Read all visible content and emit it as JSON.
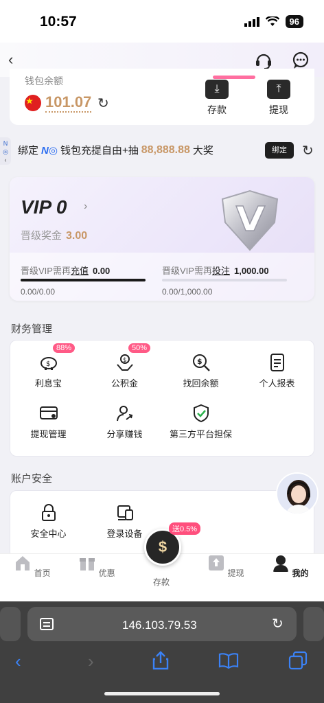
{
  "status": {
    "time": "10:57",
    "battery": "96"
  },
  "nav": {
    "back_icon": "chevron-left-icon",
    "support_icon": "headset-icon",
    "chat_icon": "chat-bubble-icon"
  },
  "wallet": {
    "label": "钱包余额",
    "amount": "101.07",
    "deposit_label": "存款",
    "withdraw_label": "提现"
  },
  "side_tab": {
    "text": "N",
    "sub": "◎"
  },
  "bind": {
    "prefix": "绑定",
    "brand": "N◎",
    "text": "钱包充提自由+抽",
    "prize": "88,888.88",
    "suffix": "大奖",
    "button": "绑定"
  },
  "vip": {
    "title": "VIP 0",
    "bonus_label": "晋级奖金",
    "bonus_value": "3.00",
    "recharge_req_prefix": "晋级VIP需再",
    "recharge_req_link": "充值",
    "recharge_req_value": "0.00",
    "recharge_progress_text": "0.00/0.00",
    "recharge_progress": 1.0,
    "bet_req_prefix": "晋级VIP需再",
    "bet_req_link": "投注",
    "bet_req_value": "1,000.00",
    "bet_progress_text": "0.00/1,000.00",
    "bet_progress": 0.0
  },
  "finance": {
    "title": "财务管理",
    "items": [
      {
        "label": "利息宝",
        "icon": "piggy-bank-icon",
        "tag": "88%"
      },
      {
        "label": "公积金",
        "icon": "hand-coin-icon",
        "tag": "50%"
      },
      {
        "label": "找回余额",
        "icon": "dollar-search-icon",
        "tag": ""
      },
      {
        "label": "个人报表",
        "icon": "document-icon",
        "tag": ""
      },
      {
        "label": "提现管理",
        "icon": "card-icon",
        "tag": ""
      },
      {
        "label": "分享赚钱",
        "icon": "share-user-icon",
        "tag": ""
      },
      {
        "label": "第三方平台担保",
        "icon": "shield-check-icon",
        "tag": ""
      }
    ]
  },
  "security": {
    "title": "账户安全",
    "items": [
      {
        "label": "安全中心",
        "icon": "lock-icon"
      },
      {
        "label": "登录设备",
        "icon": "device-icon"
      }
    ]
  },
  "tabbar": {
    "items": [
      {
        "label": "首页",
        "icon": "home-icon"
      },
      {
        "label": "优惠",
        "icon": "gift-icon"
      },
      {
        "label": "存款",
        "icon": "deposit-coin-icon"
      },
      {
        "label": "提现",
        "icon": "withdraw-icon"
      },
      {
        "label": "我的",
        "icon": "user-icon"
      }
    ],
    "center_tag": "送0.5%"
  },
  "browser": {
    "url": "146.103.79.53"
  },
  "colors": {
    "gold": "#c89766",
    "pink": "#ff5a86",
    "accent_blue": "#3b82f6"
  }
}
